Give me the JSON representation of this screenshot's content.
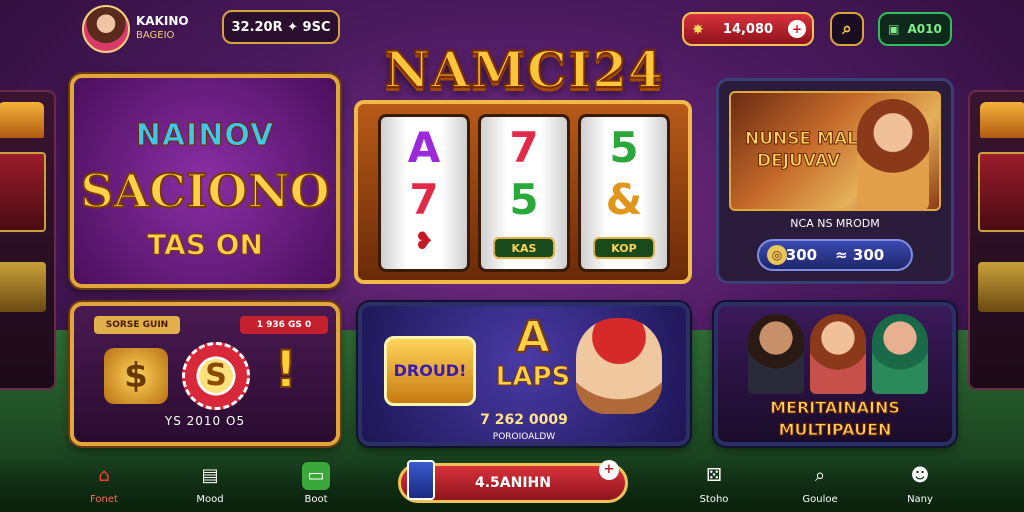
{
  "player": {
    "name": "KAKINO",
    "subtitle": "BAGEIO"
  },
  "header": {
    "balance": "32.20R ✦ 9SC",
    "coins": "14,080",
    "gems": "A010",
    "icons": {
      "avatar": "avatar",
      "search": "search-icon",
      "ticket": "ticket-icon",
      "gem": "gem-icon",
      "plus": "plus-icon"
    }
  },
  "logo": "NAMCI24",
  "promo_left": {
    "line1": "NAINOV",
    "line2": "SACIONO",
    "line3": "TAS ON"
  },
  "slot": {
    "reels": [
      {
        "top": "A",
        "mid": "7",
        "tag": ""
      },
      {
        "top": "7",
        "mid": "5",
        "tag": "KAS"
      },
      {
        "top": "5",
        "mid": "&",
        "tag": "KOP"
      }
    ],
    "colors": {
      "A": "#9b2ad8",
      "7": "#e02a4a",
      "5": "#2aa83a",
      "&": "#e0961a"
    }
  },
  "promo_right_top": {
    "title": "NUNSE MALS",
    "subtitle": "DEJUVAV",
    "caption": "NCA NS MRODM",
    "price": "300",
    "price_suffix": "≈ 300"
  },
  "panel_left_bottom": {
    "label_left": "SORSE GUIN",
    "label_right": "1 936 GS 0",
    "bag": "$",
    "chip": "S",
    "bang": "!",
    "footer": "YS 2010 O5"
  },
  "panel_mid_bottom": {
    "badge": "DROUD!",
    "letter": "A",
    "word": "LAPS",
    "amount": "7 262 0009",
    "small": "POROIOALDW"
  },
  "panel_right_bottom": {
    "title1": "MERITAINAINS",
    "title2": "MULTIPAUEN"
  },
  "bottom_nav": [
    {
      "label": "Fonet",
      "icon": "home-icon",
      "active": true
    },
    {
      "label": "Mood",
      "icon": "bag-icon",
      "active": false
    },
    {
      "label": "Boot",
      "icon": "boot-icon",
      "active": false
    },
    {
      "label": "Stoho",
      "icon": "dice-icon",
      "active": false
    },
    {
      "label": "Gouloe",
      "icon": "search-icon",
      "active": false
    },
    {
      "label": "Nany",
      "icon": "profile-icon",
      "active": false
    }
  ],
  "spin_button": "4.5ANIHN",
  "accent_colors": {
    "gold": "#e2a73c",
    "red": "#c41a26",
    "purple": "#4a1a5e",
    "green": "#2fbf5a"
  }
}
